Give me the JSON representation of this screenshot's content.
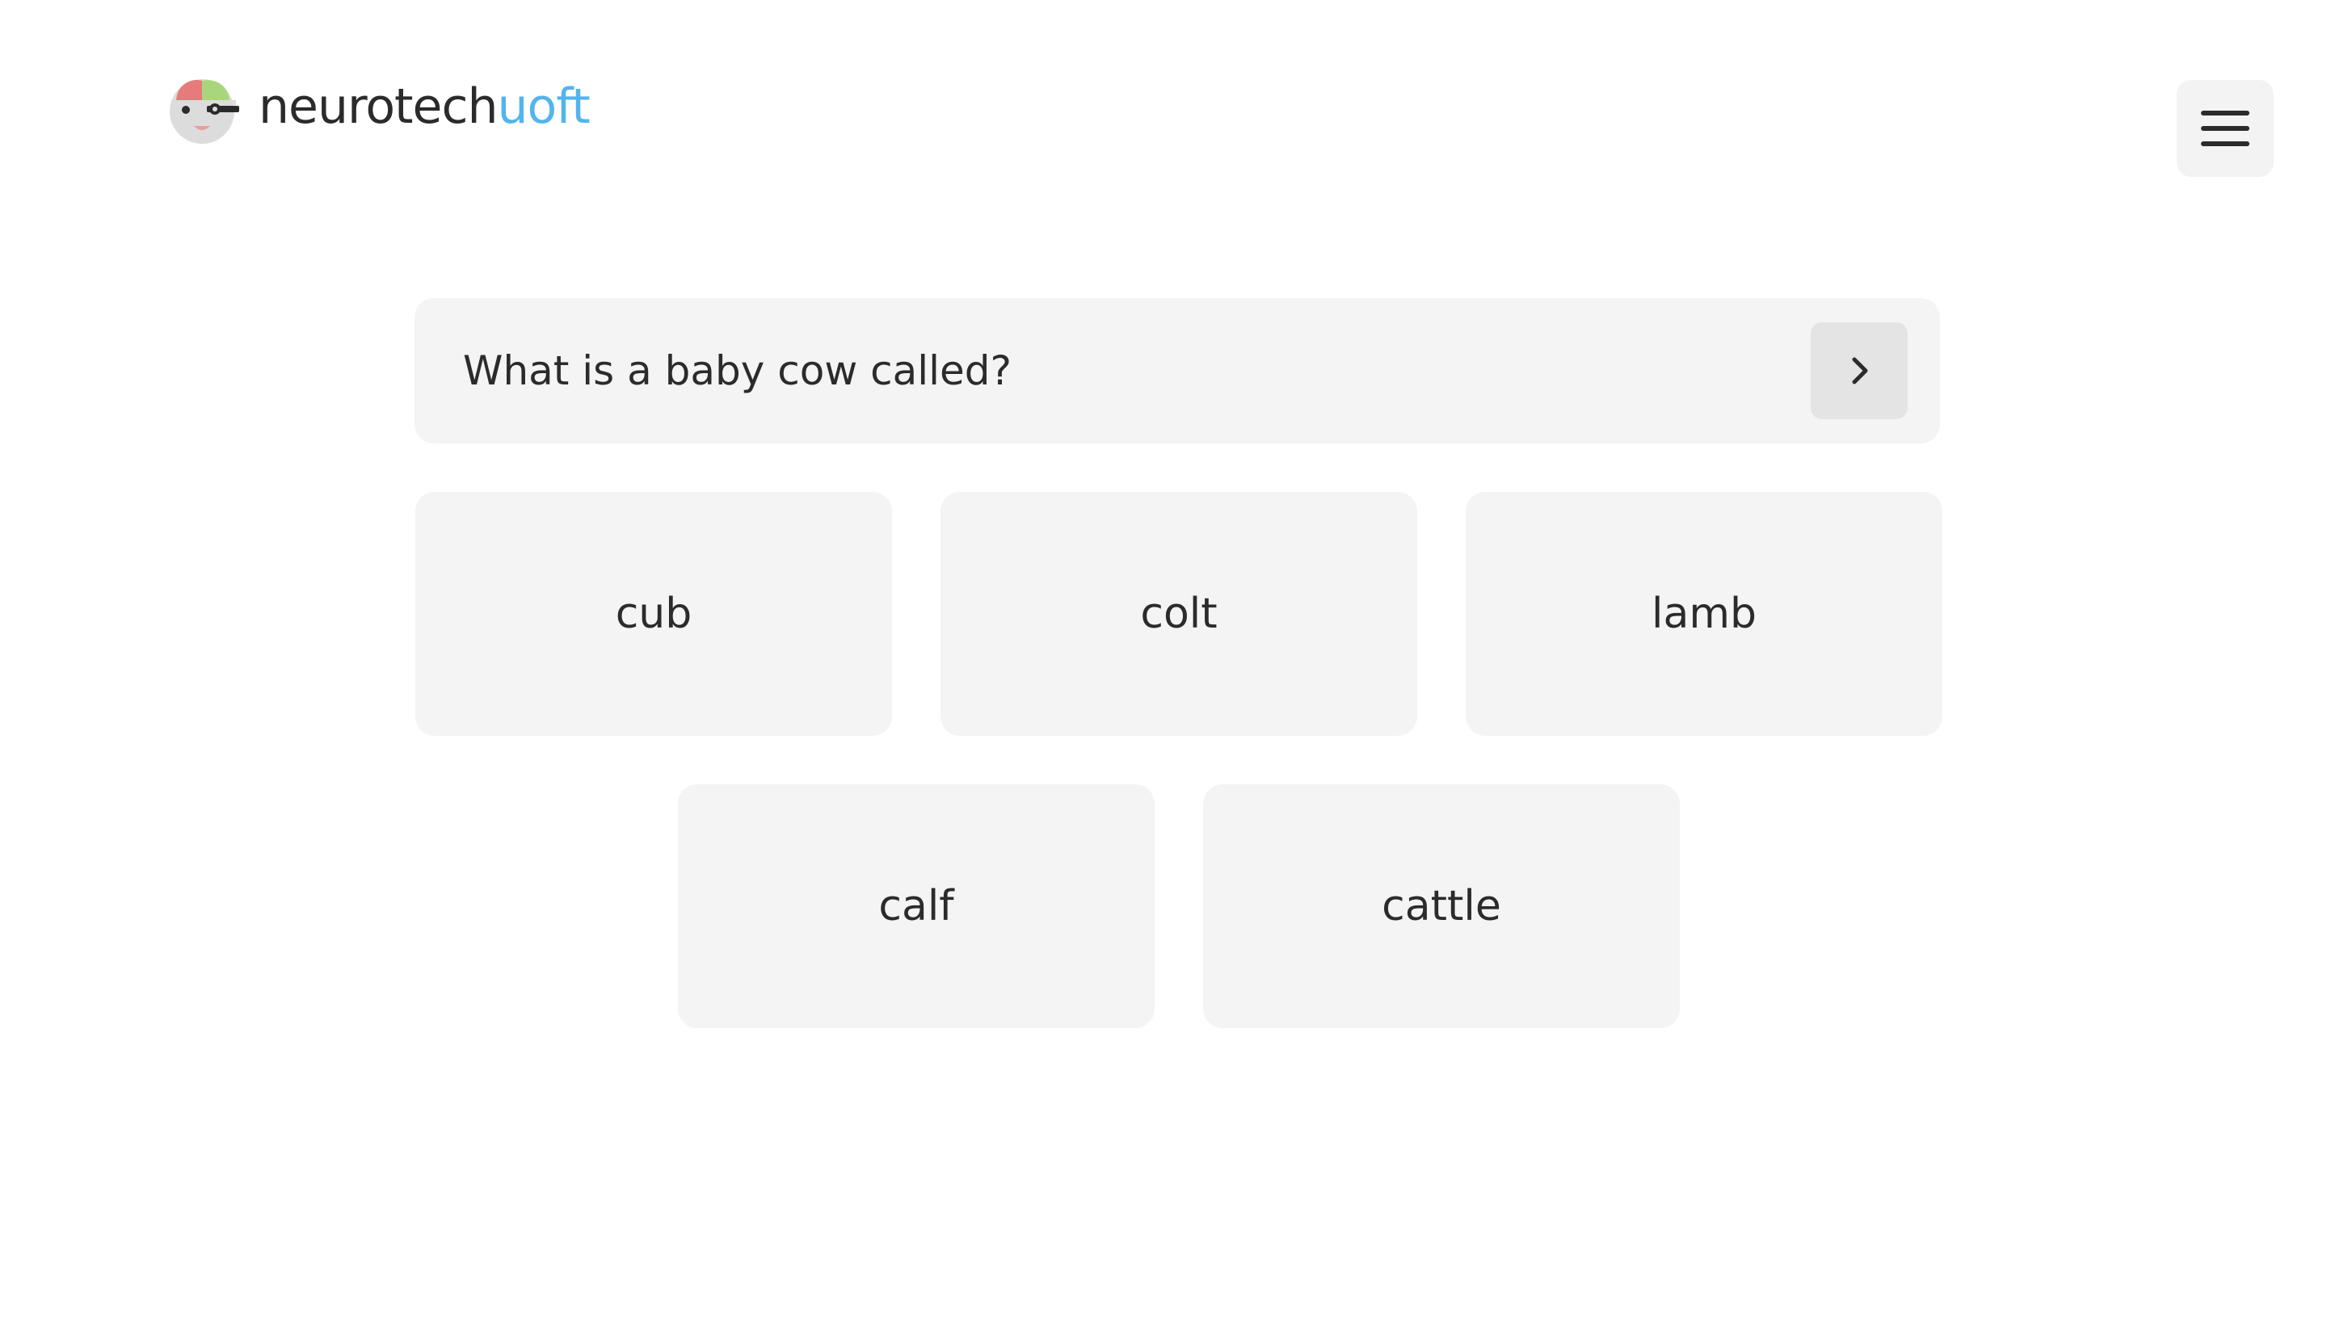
{
  "header": {
    "brand_main": "neurotech",
    "brand_accent": "uoft",
    "logo_icon": "brain-headset-logo-icon",
    "menu_icon": "hamburger-menu-icon"
  },
  "quiz": {
    "question": "What is a baby cow called?",
    "next_icon": "chevron-right-icon",
    "options": [
      "cub",
      "colt",
      "lamb",
      "calf",
      "cattle"
    ]
  },
  "colors": {
    "accent": "#53b4ee",
    "text": "#2b2b2b",
    "card_background": "#f4f4f4"
  }
}
